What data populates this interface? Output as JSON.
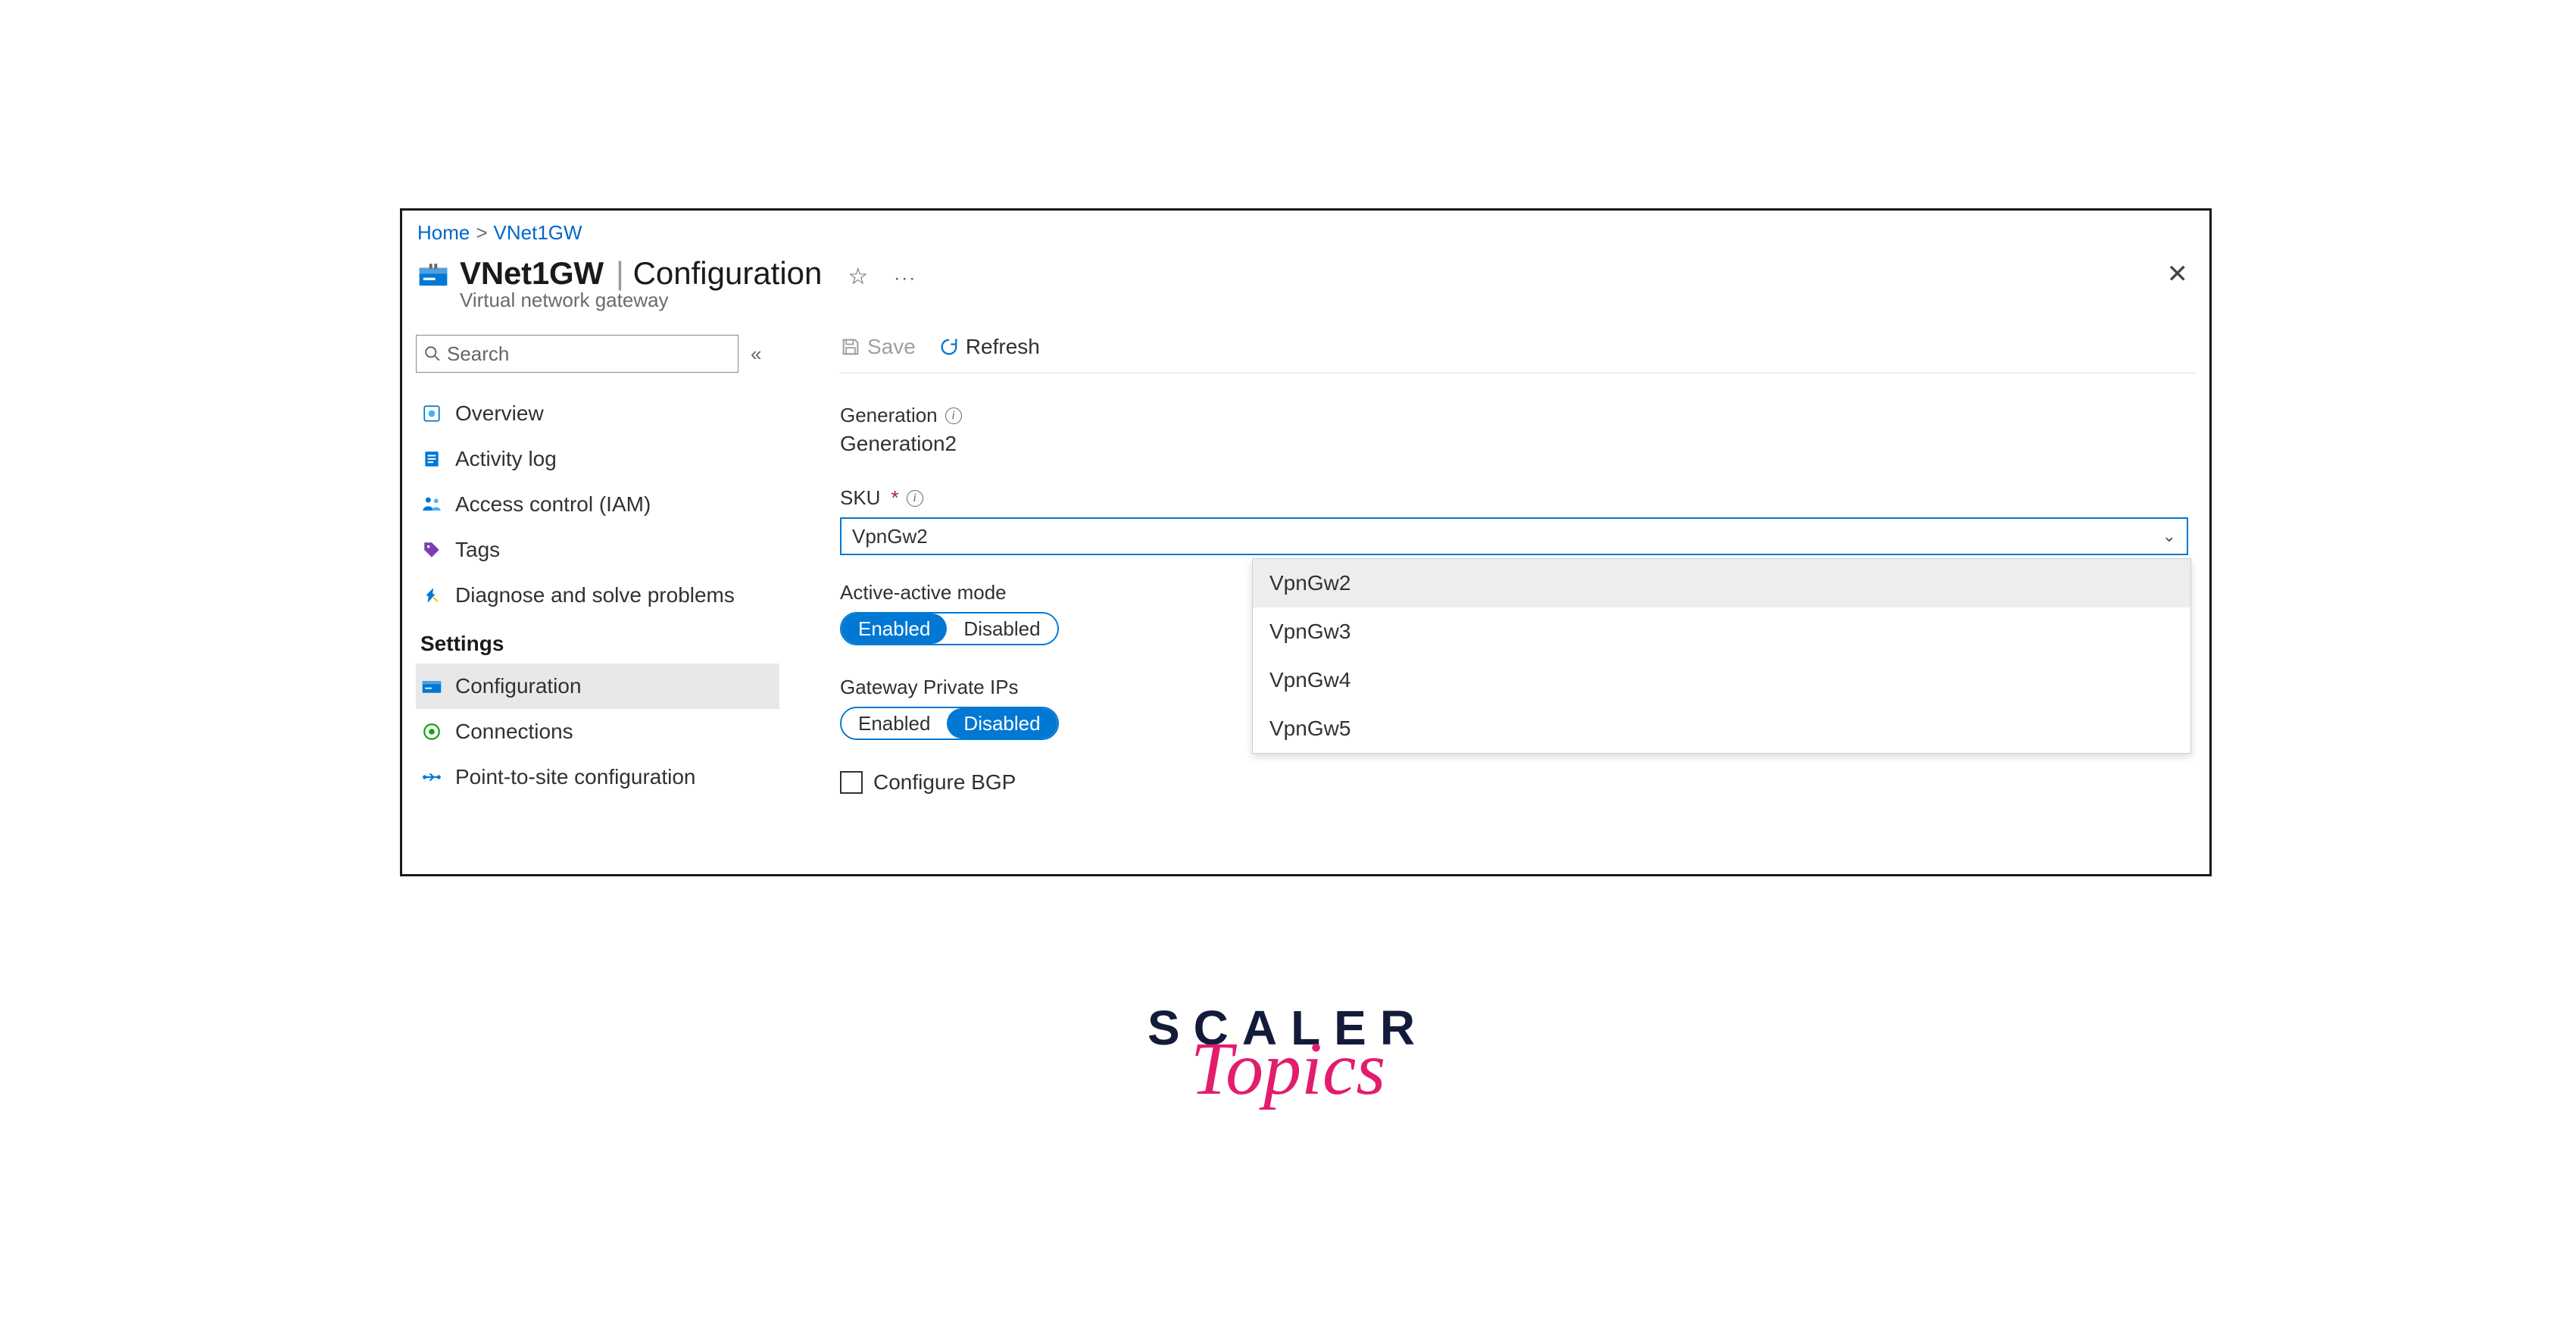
{
  "breadcrumb": {
    "home": "Home",
    "current": "VNet1GW"
  },
  "header": {
    "name": "VNet1GW",
    "page": "Configuration",
    "subtitle": "Virtual network gateway"
  },
  "search": {
    "placeholder": "Search"
  },
  "sidebar": {
    "items": [
      {
        "label": "Overview"
      },
      {
        "label": "Activity log"
      },
      {
        "label": "Access control (IAM)"
      },
      {
        "label": "Tags"
      },
      {
        "label": "Diagnose and solve problems"
      }
    ],
    "heading_settings": "Settings",
    "settings_items": [
      {
        "label": "Configuration"
      },
      {
        "label": "Connections"
      },
      {
        "label": "Point-to-site configuration"
      }
    ]
  },
  "toolbar": {
    "save": "Save",
    "refresh": "Refresh"
  },
  "form": {
    "generation_label": "Generation",
    "generation_value": "Generation2",
    "sku_label": "SKU",
    "sku_selected": "VpnGw2",
    "sku_options": [
      "VpnGw2",
      "VpnGw3",
      "VpnGw4",
      "VpnGw5"
    ],
    "active_active_label": "Active-active mode",
    "enabled": "Enabled",
    "disabled": "Disabled",
    "gateway_private_label": "Gateway Private IPs",
    "bgp_label": "Configure BGP"
  },
  "watermark": {
    "line1": "SCALER",
    "line2": "Topics"
  }
}
